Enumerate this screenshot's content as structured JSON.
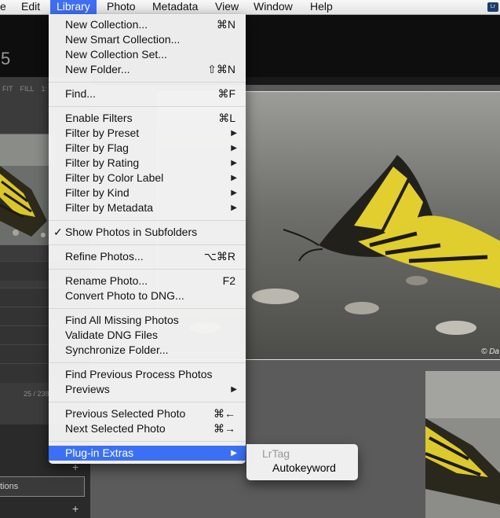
{
  "menubar": {
    "items": [
      "e",
      "Edit",
      "Library",
      "Photo",
      "Metadata",
      "View",
      "Window",
      "Help"
    ],
    "active": "Library"
  },
  "app": {
    "badge": "Lr",
    "module_number": "5",
    "zoom_options": [
      "FIT",
      "FILL",
      "1:"
    ],
    "folder_count": "25 / 238",
    "panel_field": "tions",
    "photo_credit": "© Da"
  },
  "library_menu": [
    {
      "label": "New Collection...",
      "shortcut": "⌘N"
    },
    {
      "label": "New Smart Collection...",
      "shortcut": ""
    },
    {
      "label": "New Collection Set...",
      "shortcut": ""
    },
    {
      "label": "New Folder...",
      "shortcut": "⇧⌘N"
    },
    {
      "label": "Find...",
      "shortcut": "⌘F"
    },
    {
      "label": "Enable Filters",
      "shortcut": "⌘L"
    },
    {
      "label": "Filter by Preset",
      "submenu": true
    },
    {
      "label": "Filter by Flag",
      "submenu": true
    },
    {
      "label": "Filter by Rating",
      "submenu": true
    },
    {
      "label": "Filter by Color Label",
      "submenu": true
    },
    {
      "label": "Filter by Kind",
      "submenu": true
    },
    {
      "label": "Filter by Metadata",
      "submenu": true
    },
    {
      "label": "Show Photos in Subfolders",
      "checked": true,
      "check_mark": "✓"
    },
    {
      "label": "Refine Photos...",
      "shortcut": "⌥⌘R"
    },
    {
      "label": "Rename Photo...",
      "shortcut": "F2"
    },
    {
      "label": "Convert Photo to DNG...",
      "shortcut": ""
    },
    {
      "label": "Find All Missing Photos",
      "shortcut": ""
    },
    {
      "label": "Validate DNG Files",
      "shortcut": ""
    },
    {
      "label": "Synchronize Folder...",
      "shortcut": ""
    },
    {
      "label": "Find Previous Process Photos",
      "shortcut": ""
    },
    {
      "label": "Previews",
      "submenu": true
    },
    {
      "label": "Previous Selected Photo",
      "shortcut": "⌘←"
    },
    {
      "label": "Next Selected Photo",
      "shortcut": "⌘→"
    },
    {
      "label": "Plug-in Extras",
      "submenu": true,
      "highlighted": true
    }
  ],
  "plugin_submenu": {
    "header": "LrTag",
    "items": [
      "Autokeyword"
    ]
  },
  "colors": {
    "highlight": "#3b70f4",
    "menu_bg": "#f4f4f4",
    "lr_dark": "#0e0e0e"
  },
  "icons": {
    "submenu_arrow": "▶",
    "add_icon": "+"
  }
}
